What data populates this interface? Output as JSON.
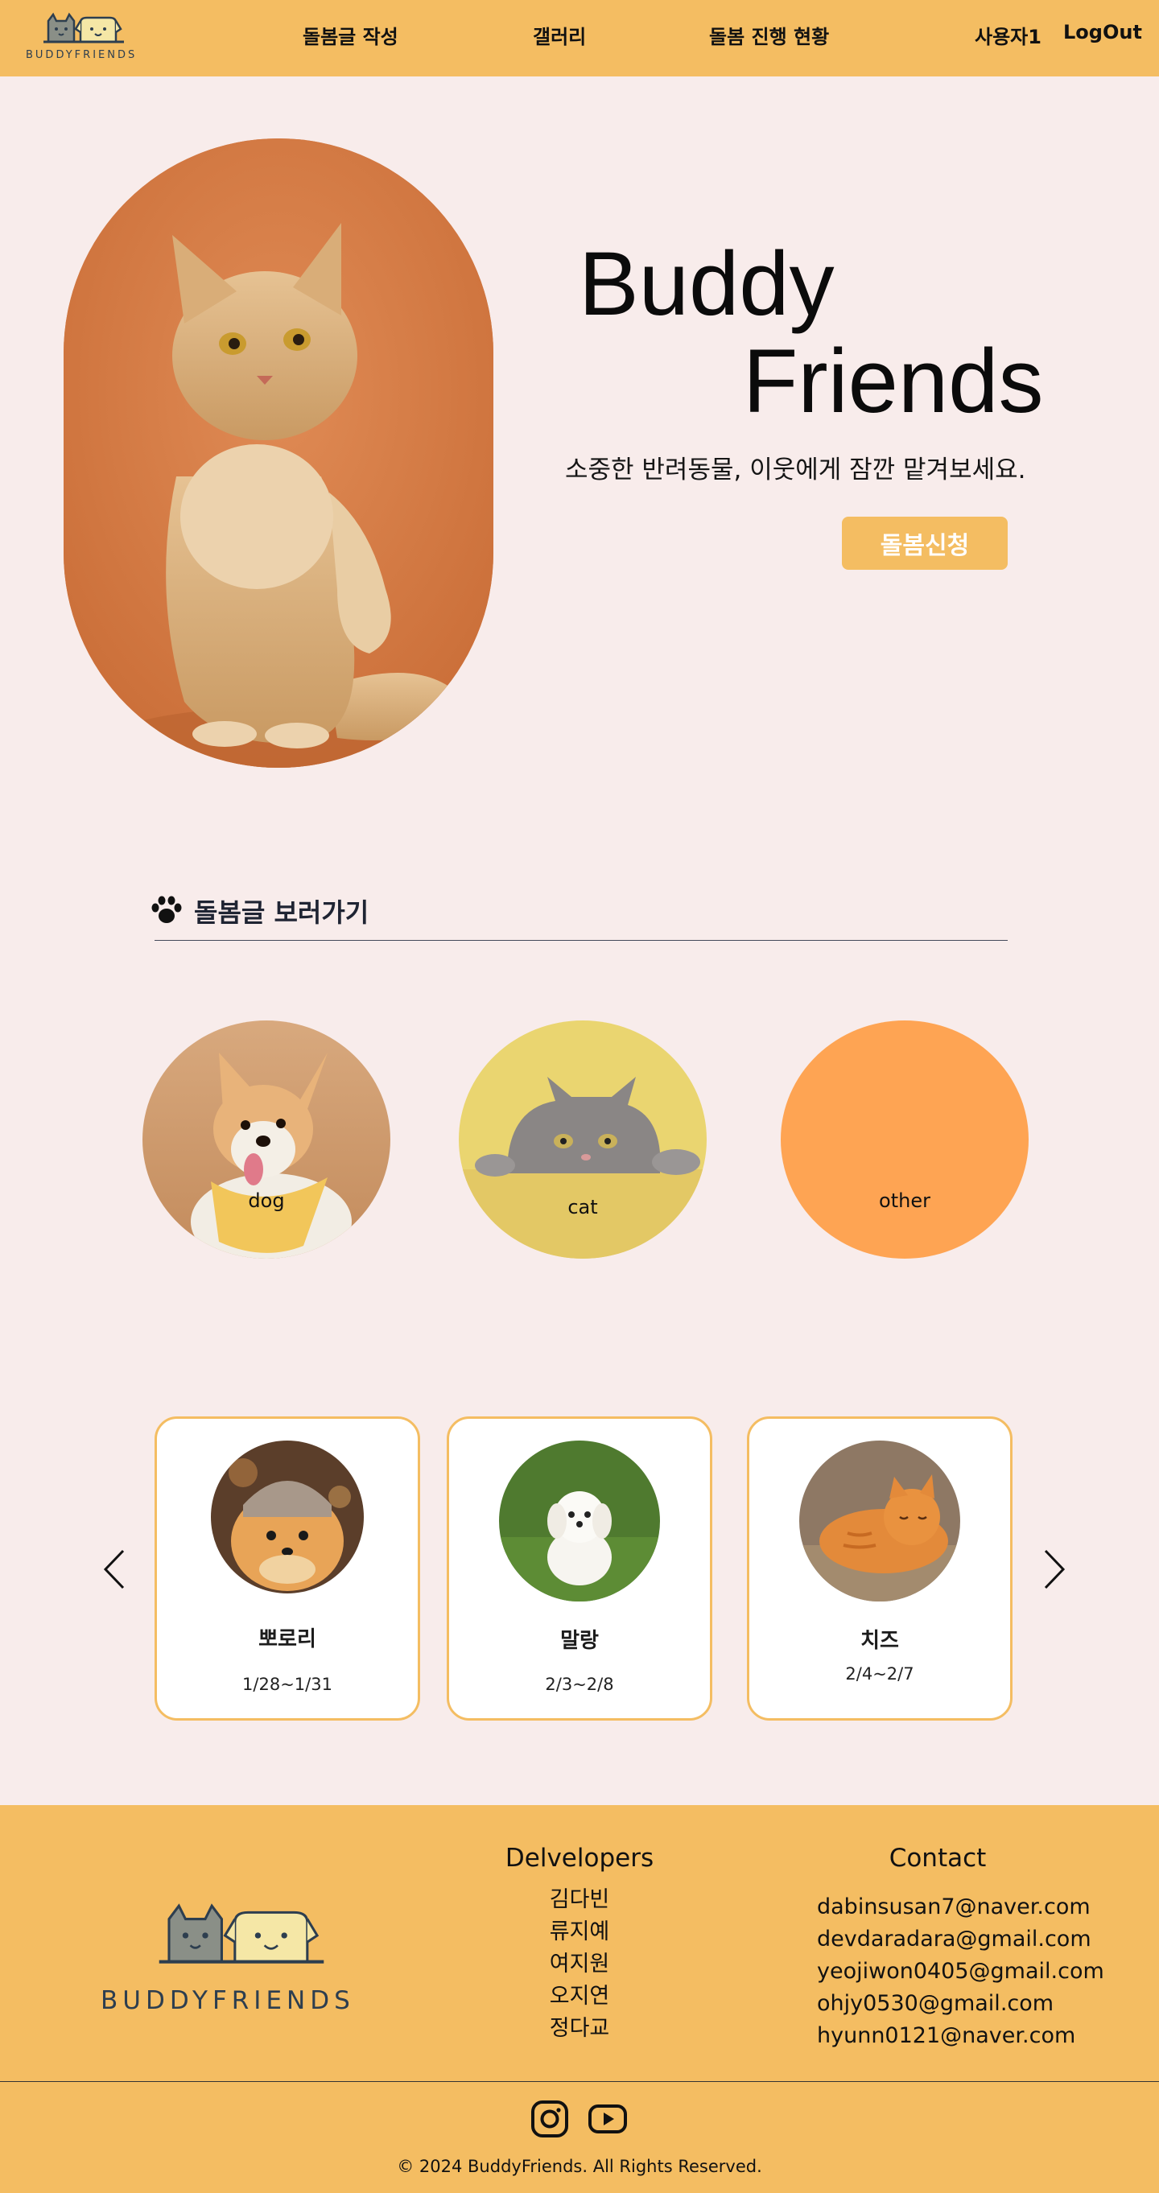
{
  "brand": {
    "name": "BUDDYFRIENDS",
    "accent": "#f4bd62",
    "background": "#f8eceb"
  },
  "header": {
    "nav": [
      "돌봄글 작성",
      "갤러리",
      "돌봄 진행 현황"
    ],
    "user": "사용자1",
    "logout": "LogOut"
  },
  "hero": {
    "title_line1": "Buddy",
    "title_line2": "Friends",
    "subtitle": "소중한 반려동물, 이웃에게 잠깐 맡겨보세요.",
    "cta": "돌봄신청"
  },
  "section": {
    "title": "돌봄글 보러가기",
    "icon": "paw-icon"
  },
  "categories": [
    {
      "label": "dog"
    },
    {
      "label": "cat"
    },
    {
      "label": "other"
    }
  ],
  "carousel": {
    "cards": [
      {
        "name": "뽀로리",
        "dates": "1/28~1/31"
      },
      {
        "name": "말랑",
        "dates": "2/3~2/8"
      },
      {
        "name": "치즈",
        "dates": "2/4~2/7"
      }
    ]
  },
  "footer": {
    "developers_title": "Delvelopers",
    "developers": [
      "김다빈",
      "류지예",
      "여지원",
      "오지연",
      "정다교"
    ],
    "contact_title": "Contact",
    "contacts": [
      "dabinsusan7@naver.com",
      "devdaradara@gmail.com",
      "yeojiwon0405@gmail.com",
      "ohjy0530@gmail.com",
      "hyunn0121@naver.com"
    ],
    "social": [
      "instagram-icon",
      "youtube-icon"
    ],
    "copyright": "© 2024 BuddyFriends. All Rights Reserved."
  }
}
